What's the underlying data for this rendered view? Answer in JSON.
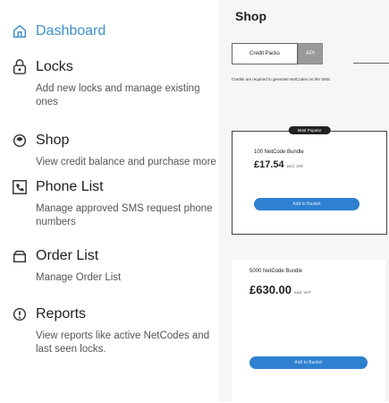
{
  "sidebar": {
    "items": [
      {
        "title": "Dashboard",
        "desc": ""
      },
      {
        "title": "Locks",
        "desc": "Add new locks and manage existing ones"
      },
      {
        "title": "Shop",
        "desc": "View credit balance and purchase more"
      },
      {
        "title": "Phone List",
        "desc": "Manage approved SMS request phone numbers"
      },
      {
        "title": "Order List",
        "desc": "Manage Order List"
      },
      {
        "title": "Reports",
        "desc": "View reports like active NetCodes and last seen locks."
      }
    ]
  },
  "main": {
    "title": "Shop",
    "tabs": {
      "credit": "Credit Packs",
      "api": "API"
    },
    "notice": "Credits are required to generate NetCodes on the SMS.",
    "cards": [
      {
        "badge": "Most Popular",
        "name": "100 NetCode Bundle",
        "price": "£17.54",
        "vat": "excl. VAT",
        "button": "Add to Basket"
      },
      {
        "badge": "",
        "name": "5000 NetCode Bundle",
        "price": "£630.00",
        "vat": "excl. VAT",
        "button": "Add to Basket"
      }
    ]
  },
  "colors": {
    "accent": "#3c8fcf",
    "button": "#2f80d1",
    "panel_bg": "#f6f6f6"
  },
  "icons": [
    "home-icon",
    "lock-icon",
    "shop-icon",
    "phone-list-icon",
    "order-list-icon",
    "reports-icon"
  ]
}
